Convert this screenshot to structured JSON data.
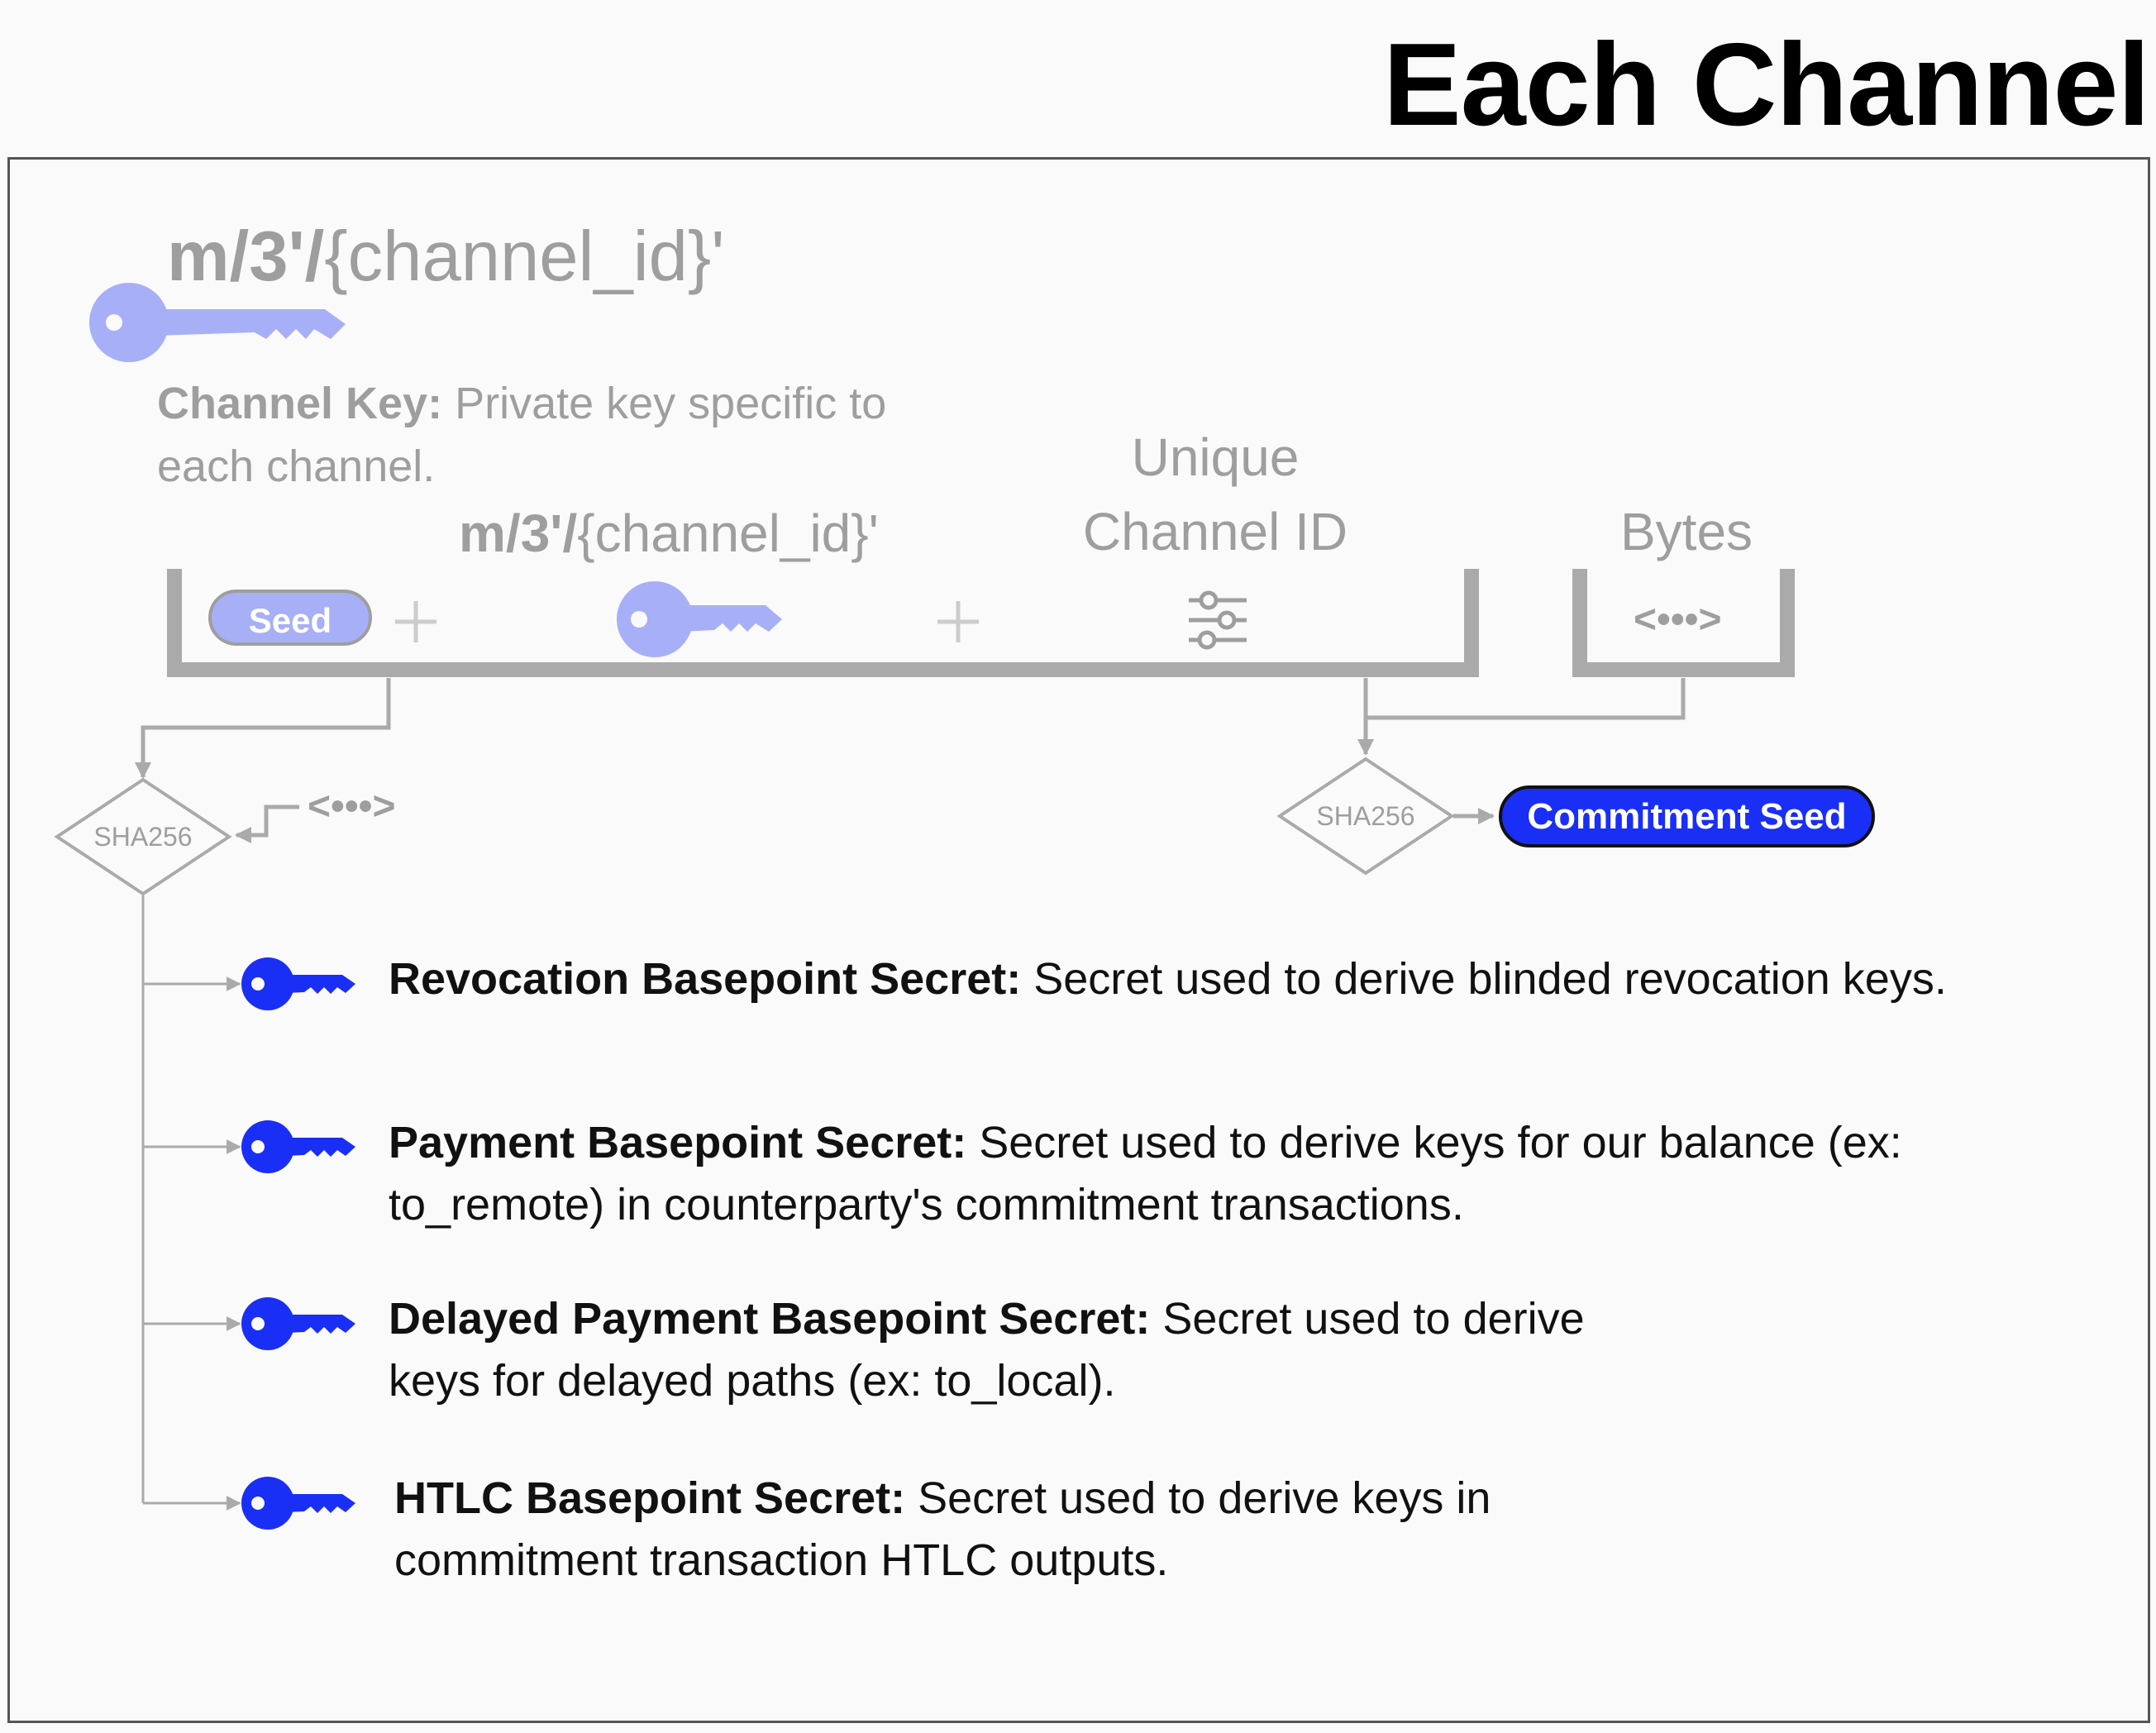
{
  "title": "Each Channel",
  "channel_key": {
    "path_bold": "m/3'/",
    "path_light": "{channel_id}'",
    "label": "Channel Key:",
    "description": " Private key specific to each channel."
  },
  "input_group": {
    "seed_label": "Seed",
    "plus": "+",
    "path_bold": "m/3'/",
    "path_light": "{channel_id}'",
    "unique_label_line1": "Unique",
    "unique_label_line2": "Channel ID"
  },
  "bytes": {
    "label": "Bytes",
    "glyph": "<•••>"
  },
  "side_bytes_glyph": "<•••>",
  "hash_left": "SHA256",
  "hash_right": "SHA256",
  "commitment_seed": "Commitment Seed",
  "secrets": [
    {
      "label": "Revocation Basepoint Secret:",
      "text": " Secret used to derive blinded revocation keys."
    },
    {
      "label": "Payment Basepoint Secret:",
      "text": " Secret used to derive keys for our balance (ex: to_remote) in counterparty's commitment transactions."
    },
    {
      "label": "Delayed Payment Basepoint Secret:",
      "text": " Secret used to derive keys for delayed paths (ex: to_local)."
    },
    {
      "label": "HTLC Basepoint Secret:",
      "text": " Secret used to derive keys in commitment transaction HTLC outputs."
    }
  ],
  "colors": {
    "accent_blue": "#1a2ff5",
    "light_blue": "#a7aff7",
    "gray": "#9e9e9e",
    "line_gray": "#aaaaaa"
  },
  "icons": [
    "key-icon",
    "sliders-icon",
    "bytes-icon",
    "arrow-icon"
  ]
}
